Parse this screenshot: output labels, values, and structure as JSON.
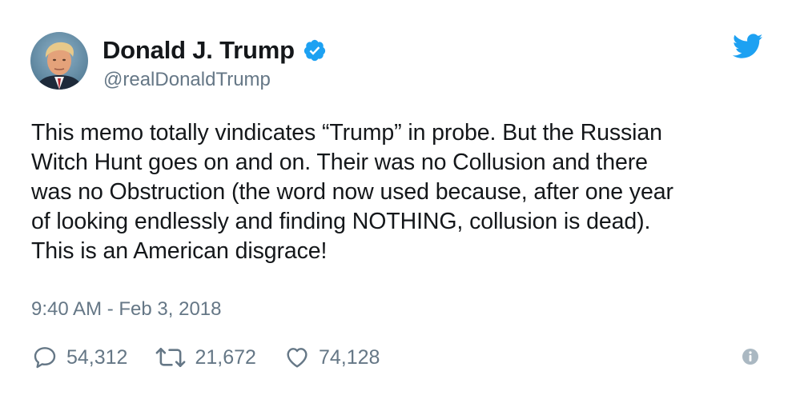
{
  "user": {
    "display_name": "Donald J. Trump",
    "handle": "@realDonaldTrump",
    "verified": true
  },
  "tweet": {
    "lines": [
      "This memo totally vindicates “Trump” in probe. But the Russian",
      "Witch Hunt goes on and on. Their was no Collusion and there",
      "was no Obstruction (the word now used because, after one year",
      "of looking endlessly and finding NOTHING, collusion is dead).",
      "This is an American disgrace!"
    ],
    "timestamp": "9:40 AM - Feb 3, 2018"
  },
  "actions": {
    "replies": "54,312",
    "retweets": "21,672",
    "likes": "74,128"
  },
  "icons": {
    "verified": "verified-badge-icon",
    "brand": "twitter-bird-icon",
    "reply": "reply-bubble-icon",
    "retweet": "retweet-icon",
    "like": "heart-icon",
    "info": "info-icon"
  },
  "colors": {
    "brand_blue": "#1da1f2",
    "text_primary": "#14171a",
    "text_secondary": "#657786"
  }
}
